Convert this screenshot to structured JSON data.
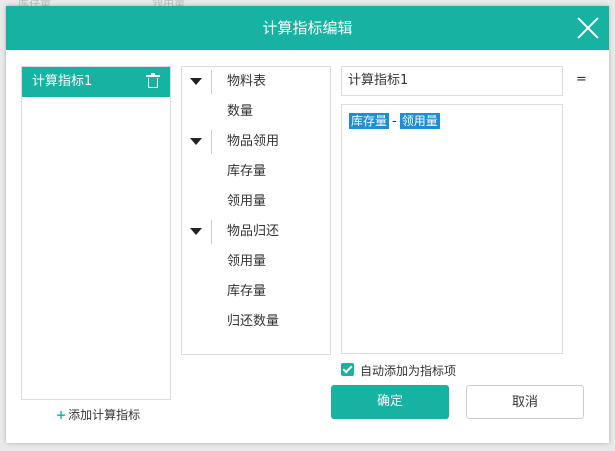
{
  "background": {
    "col1": "库存量",
    "col2": "领用量"
  },
  "dialog": {
    "title": "计算指标编辑"
  },
  "metrics": {
    "items": [
      {
        "label": "计算指标1"
      }
    ],
    "add_label": "添加计算指标"
  },
  "tree": {
    "groups": [
      {
        "label": "物料表",
        "children": [
          "数量"
        ]
      },
      {
        "label": "物品领用",
        "children": [
          "库存量",
          "领用量"
        ]
      },
      {
        "label": "物品归还",
        "children": [
          "领用量",
          "库存量",
          "归还数量"
        ]
      }
    ]
  },
  "editor": {
    "name_value": "计算指标1",
    "equals": "=",
    "expression": {
      "left": "库存量",
      "operator": "-",
      "right": "领用量"
    }
  },
  "options": {
    "auto_add_label": "自动添加为指标项",
    "auto_add_checked": true
  },
  "buttons": {
    "ok": "确定",
    "cancel": "取消"
  },
  "colors": {
    "accent": "#16b2a2",
    "token": "#1a8fd8"
  }
}
